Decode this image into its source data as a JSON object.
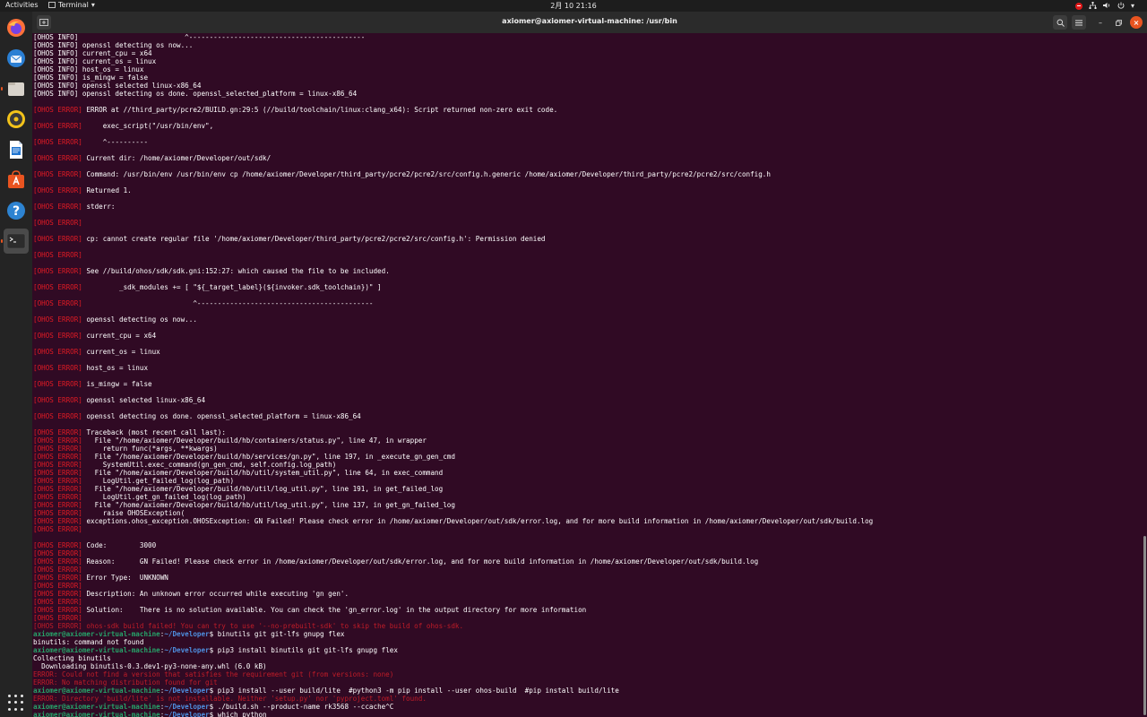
{
  "topbar": {
    "activities": "Activities",
    "app_menu": "Terminal",
    "clock": "2月 10  21:16"
  },
  "dock": {
    "items": [
      {
        "name": "firefox-icon",
        "color": "#ff7139"
      },
      {
        "name": "thunderbird-icon",
        "color": "#2a7fd4"
      },
      {
        "name": "files-icon",
        "color": "#d8d3cb"
      },
      {
        "name": "rhythmbox-icon",
        "color": "#f3c31a"
      },
      {
        "name": "writer-icon",
        "color": "#1f74cf"
      },
      {
        "name": "software-icon",
        "color": "#e95420"
      },
      {
        "name": "help-icon",
        "color": "#2d83d1"
      },
      {
        "name": "terminal-icon",
        "color": "#2c2c2c"
      }
    ]
  },
  "window": {
    "title": "axiomer@axiomer-virtual-machine: /usr/bin"
  },
  "prompt": {
    "user": "axiomer@axiomer-virtual-machine",
    "path": "~/Developer"
  },
  "terminal_lines": [
    {
      "t": "plain",
      "text": "[OHOS INFO]                          ^-------------------------------------------"
    },
    {
      "t": "plain",
      "text": "[OHOS INFO] openssl detecting os now..."
    },
    {
      "t": "plain",
      "text": "[OHOS INFO] current_cpu = x64"
    },
    {
      "t": "plain",
      "text": "[OHOS INFO] current_os = linux"
    },
    {
      "t": "plain",
      "text": "[OHOS INFO] host_os = linux"
    },
    {
      "t": "plain",
      "text": "[OHOS INFO] is_mingw = false"
    },
    {
      "t": "plain",
      "text": "[OHOS INFO] openssl selected linux-x86_64"
    },
    {
      "t": "plain",
      "text": "[OHOS INFO] openssl detecting os done. openssl_selected_platform = linux-x86_64"
    },
    {
      "t": "blank"
    },
    {
      "t": "err",
      "text": "ERROR at //third_party/pcre2/BUILD.gn:29:5 (//build/toolchain/linux:clang_x64): Script returned non-zero exit code."
    },
    {
      "t": "blank"
    },
    {
      "t": "err",
      "text": "    exec_script(\"/usr/bin/env\","
    },
    {
      "t": "blank"
    },
    {
      "t": "err",
      "text": "    ^----------"
    },
    {
      "t": "blank"
    },
    {
      "t": "err",
      "text": "Current dir: /home/axiomer/Developer/out/sdk/"
    },
    {
      "t": "blank"
    },
    {
      "t": "err",
      "text": "Command: /usr/bin/env /usr/bin/env cp /home/axiomer/Developer/third_party/pcre2/pcre2/src/config.h.generic /home/axiomer/Developer/third_party/pcre2/pcre2/src/config.h"
    },
    {
      "t": "blank"
    },
    {
      "t": "err",
      "text": "Returned 1."
    },
    {
      "t": "blank"
    },
    {
      "t": "err",
      "text": "stderr:"
    },
    {
      "t": "blank"
    },
    {
      "t": "err",
      "text": ""
    },
    {
      "t": "blank"
    },
    {
      "t": "err",
      "text": "cp: cannot create regular file '/home/axiomer/Developer/third_party/pcre2/pcre2/src/config.h': Permission denied"
    },
    {
      "t": "blank"
    },
    {
      "t": "err",
      "text": ""
    },
    {
      "t": "blank"
    },
    {
      "t": "err",
      "text": "See //build/ohos/sdk/sdk.gni:152:27: which caused the file to be included."
    },
    {
      "t": "blank"
    },
    {
      "t": "err",
      "text": "        _sdk_modules += [ \"${_target_label}(${invoker.sdk_toolchain})\" ]"
    },
    {
      "t": "blank"
    },
    {
      "t": "err",
      "text": "                          ^-------------------------------------------"
    },
    {
      "t": "blank"
    },
    {
      "t": "err",
      "text": "openssl detecting os now..."
    },
    {
      "t": "blank"
    },
    {
      "t": "err",
      "text": "current_cpu = x64"
    },
    {
      "t": "blank"
    },
    {
      "t": "err",
      "text": "current_os = linux"
    },
    {
      "t": "blank"
    },
    {
      "t": "err",
      "text": "host_os = linux"
    },
    {
      "t": "blank"
    },
    {
      "t": "err",
      "text": "is_mingw = false"
    },
    {
      "t": "blank"
    },
    {
      "t": "err",
      "text": "openssl selected linux-x86_64"
    },
    {
      "t": "blank"
    },
    {
      "t": "err",
      "text": "openssl detecting os done. openssl_selected_platform = linux-x86_64"
    },
    {
      "t": "blank"
    },
    {
      "t": "err",
      "text": "Traceback (most recent call last):"
    },
    {
      "t": "err",
      "text": "  File \"/home/axiomer/Developer/build/hb/containers/status.py\", line 47, in wrapper"
    },
    {
      "t": "err",
      "text": "    return func(*args, **kwargs)"
    },
    {
      "t": "err",
      "text": "  File \"/home/axiomer/Developer/build/hb/services/gn.py\", line 197, in _execute_gn_gen_cmd"
    },
    {
      "t": "err",
      "text": "    SystemUtil.exec_command(gn_gen_cmd, self.config.log_path)"
    },
    {
      "t": "err",
      "text": "  File \"/home/axiomer/Developer/build/hb/util/system_util.py\", line 64, in exec_command"
    },
    {
      "t": "err",
      "text": "    LogUtil.get_failed_log(log_path)"
    },
    {
      "t": "err",
      "text": "  File \"/home/axiomer/Developer/build/hb/util/log_util.py\", line 191, in get_failed_log"
    },
    {
      "t": "err",
      "text": "    LogUtil.get_gn_failed_log(log_path)"
    },
    {
      "t": "err",
      "text": "  File \"/home/axiomer/Developer/build/hb/util/log_util.py\", line 137, in get_gn_failed_log"
    },
    {
      "t": "err",
      "text": "    raise OHOSException("
    },
    {
      "t": "err",
      "text": "exceptions.ohos_exception.OHOSException: GN Failed! Please check error in /home/axiomer/Developer/out/sdk/error.log, and for more build information in /home/axiomer/Developer/out/sdk/build.log"
    },
    {
      "t": "err",
      "text": ""
    },
    {
      "t": "blank"
    },
    {
      "t": "err",
      "text": "Code:        3000"
    },
    {
      "t": "err",
      "text": ""
    },
    {
      "t": "err",
      "text": "Reason:      GN Failed! Please check error in /home/axiomer/Developer/out/sdk/error.log, and for more build information in /home/axiomer/Developer/out/sdk/build.log"
    },
    {
      "t": "err",
      "text": ""
    },
    {
      "t": "err",
      "text": "Error Type:  UNKNOWN"
    },
    {
      "t": "err",
      "text": ""
    },
    {
      "t": "err",
      "text": "Description: An unknown error occurred while executing 'gn gen'."
    },
    {
      "t": "err",
      "text": ""
    },
    {
      "t": "err",
      "text": "Solution:    There is no solution available. You can check the 'gn_error.log' in the output directory for more information"
    },
    {
      "t": "err",
      "text": ""
    },
    {
      "t": "errfull",
      "text": "[OHOS ERROR] ohos-sdk build failed! You can try to use '--no-prebuilt-sdk' to skip the build of ohos-sdk."
    },
    {
      "t": "prompt",
      "text": "binutils git git-lfs gnupg flex"
    },
    {
      "t": "plain",
      "text": "binutils: command not found"
    },
    {
      "t": "prompt",
      "text": "pip3 install binutils git git-lfs gnupg flex"
    },
    {
      "t": "plain",
      "text": "Collecting binutils"
    },
    {
      "t": "plain",
      "text": "  Downloading binutils-0.3.dev1-py3-none-any.whl (6.0 kB)"
    },
    {
      "t": "errfull",
      "text": "ERROR: Could not find a version that satisfies the requirement git (from versions: none)"
    },
    {
      "t": "errfull",
      "text": "ERROR: No matching distribution found for git"
    },
    {
      "t": "prompt",
      "text": "pip3 install --user build/lite  #python3 -m pip install --user ohos-build  #pip install build/lite"
    },
    {
      "t": "errfull",
      "text": "ERROR: Directory 'build/lite' is not installable. Neither 'setup.py' nor 'pyproject.toml' found."
    },
    {
      "t": "prompt",
      "text": "./build.sh --product-name rk3568 --ccache^C"
    },
    {
      "t": "prompt",
      "text": "which python"
    }
  ],
  "error_tag": "[OHOS ERROR]"
}
